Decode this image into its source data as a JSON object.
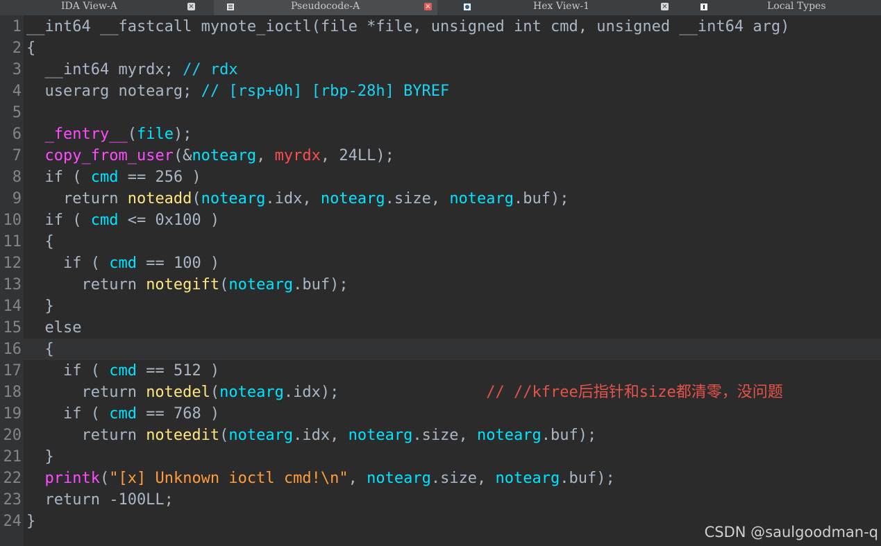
{
  "tabs": [
    {
      "label": "IDA View-A",
      "icon": "ida-view-icon",
      "active": false
    },
    {
      "label": "Pseudocode-A",
      "icon": "pseudocode-icon",
      "active": true
    },
    {
      "label": "Hex View-1",
      "icon": "hex-view-icon",
      "active": false
    },
    {
      "label": "Local Types",
      "icon": "local-types-icon",
      "active": false
    }
  ],
  "close_glyph": "×",
  "code": {
    "line_numbers": [
      "1",
      "2",
      "3",
      "4",
      "5",
      "6",
      "7",
      "8",
      "9",
      "10",
      "11",
      "12",
      "13",
      "14",
      "15",
      "16",
      "17",
      "18",
      "19",
      "20",
      "21",
      "22",
      "23",
      "24"
    ],
    "current_line": 16,
    "lines": [
      [
        [
          "ty",
          "__int64 __fastcall mynote_ioctl(file *file, unsigned int cmd, unsigned __int64 arg)"
        ]
      ],
      [
        [
          "nm",
          "{"
        ]
      ],
      [
        [
          "ty",
          "  __int64 myrdx; "
        ],
        [
          "cm",
          "// rdx"
        ]
      ],
      [
        [
          "ty",
          "  userarg notearg; "
        ],
        [
          "cm",
          "// [rsp+0h] [rbp-28h] BYREF"
        ]
      ],
      [],
      [
        [
          "nm",
          "  "
        ],
        [
          "pp",
          "_fentry__"
        ],
        [
          "nm",
          "("
        ],
        [
          "va",
          "file"
        ],
        [
          "nm",
          ");"
        ]
      ],
      [
        [
          "nm",
          "  "
        ],
        [
          "pp",
          "copy_from_user"
        ],
        [
          "nm",
          "(&"
        ],
        [
          "va",
          "notearg"
        ],
        [
          "nm",
          ", "
        ],
        [
          "gl",
          "myrdx"
        ],
        [
          "nm",
          ", 24LL);"
        ]
      ],
      [
        [
          "kw",
          "  if ( "
        ],
        [
          "va",
          "cmd"
        ],
        [
          "nm",
          " == 256 )"
        ]
      ],
      [
        [
          "kw",
          "    return "
        ],
        [
          "fn",
          "noteadd"
        ],
        [
          "nm",
          "("
        ],
        [
          "va",
          "notearg"
        ],
        [
          "nm",
          ".idx, "
        ],
        [
          "va",
          "notearg"
        ],
        [
          "nm",
          ".size, "
        ],
        [
          "va",
          "notearg"
        ],
        [
          "nm",
          ".buf);"
        ]
      ],
      [
        [
          "kw",
          "  if ( "
        ],
        [
          "va",
          "cmd"
        ],
        [
          "nm",
          " <= 0x100 )"
        ]
      ],
      [
        [
          "nm",
          "  {"
        ]
      ],
      [
        [
          "kw",
          "    if ( "
        ],
        [
          "va",
          "cmd"
        ],
        [
          "nm",
          " == 100 )"
        ]
      ],
      [
        [
          "kw",
          "      return "
        ],
        [
          "fn",
          "notegift"
        ],
        [
          "nm",
          "("
        ],
        [
          "va",
          "notearg"
        ],
        [
          "nm",
          ".buf);"
        ]
      ],
      [
        [
          "nm",
          "  }"
        ]
      ],
      [
        [
          "kw",
          "  else"
        ]
      ],
      [
        [
          "nm",
          "  {"
        ]
      ],
      [
        [
          "kw",
          "    if ( "
        ],
        [
          "va",
          "cmd"
        ],
        [
          "nm",
          " == 512 )"
        ]
      ],
      [
        [
          "kw",
          "      return "
        ],
        [
          "fn",
          "notedel"
        ],
        [
          "nm",
          "("
        ],
        [
          "va",
          "notearg"
        ],
        [
          "nm",
          ".idx);                "
        ],
        [
          "zh",
          "// //kfree后指针和size都清零，没问题"
        ]
      ],
      [
        [
          "kw",
          "    if ( "
        ],
        [
          "va",
          "cmd"
        ],
        [
          "nm",
          " == 768 )"
        ]
      ],
      [
        [
          "kw",
          "      return "
        ],
        [
          "fn",
          "noteedit"
        ],
        [
          "nm",
          "("
        ],
        [
          "va",
          "notearg"
        ],
        [
          "nm",
          ".idx, "
        ],
        [
          "va",
          "notearg"
        ],
        [
          "nm",
          ".size, "
        ],
        [
          "va",
          "notearg"
        ],
        [
          "nm",
          ".buf);"
        ]
      ],
      [
        [
          "nm",
          "  }"
        ]
      ],
      [
        [
          "nm",
          "  "
        ],
        [
          "pp",
          "printk"
        ],
        [
          "nm",
          "("
        ],
        [
          "st",
          "\"[x] Unknown ioctl cmd!\\n\""
        ],
        [
          "nm",
          ", "
        ],
        [
          "va",
          "notearg"
        ],
        [
          "nm",
          ".size, "
        ],
        [
          "va",
          "notearg"
        ],
        [
          "nm",
          ".buf);"
        ]
      ],
      [
        [
          "kw",
          "  return -100LL;"
        ]
      ],
      [
        [
          "nm",
          "}"
        ]
      ]
    ]
  },
  "watermark": "CSDN @saulgoodman-q",
  "colors": {
    "background": "#2b2b2b",
    "gutter": "#313335",
    "variable": "#00e5ff",
    "function": "#ffe680",
    "comment": "#19d3f2",
    "string": "#ff9d3c",
    "global": "#ff4d4d",
    "import": "#ff4cff"
  }
}
